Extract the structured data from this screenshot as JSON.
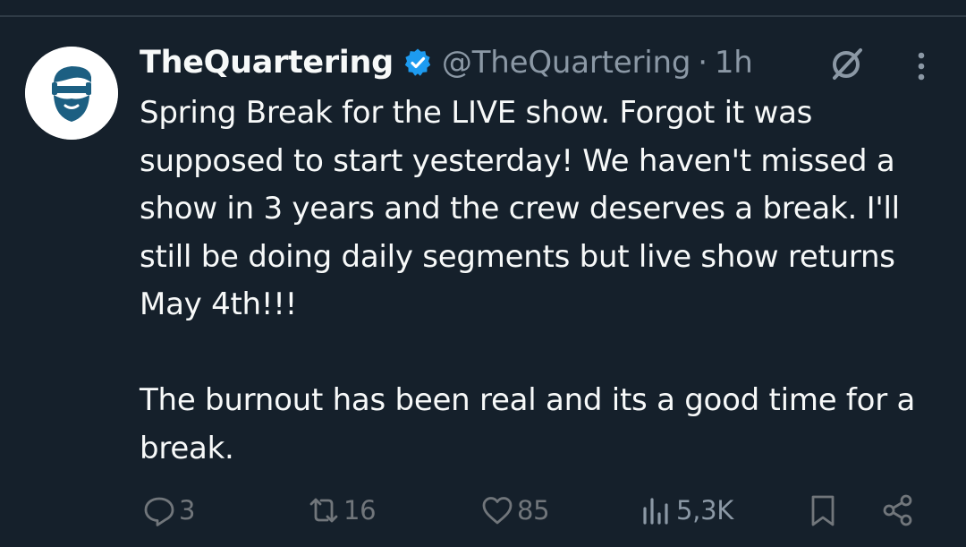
{
  "post": {
    "author": {
      "display_name": "TheQuartering",
      "handle": "@TheQuartering",
      "separator": "·",
      "time": "1h",
      "verified": true,
      "avatar_icon": "bearded-man-avatar-icon"
    },
    "text": [
      "Spring Break for the LIVE show. Forgot it was supposed to start yesterday! We haven't missed a show in 3 years and the crew deserves a break. I'll still be doing daily segments but live show returns May 4th!!!",
      "The burnout has been real and its a good time for a break."
    ],
    "actions": {
      "replies": "3",
      "reposts": "16",
      "likes": "85",
      "views": "5,3K"
    }
  },
  "colors": {
    "background": "#15202b",
    "text": "#f7f9f9",
    "muted": "#71767b",
    "verified": "#1d9bf0",
    "avatar_accent": "#1c5f82"
  }
}
